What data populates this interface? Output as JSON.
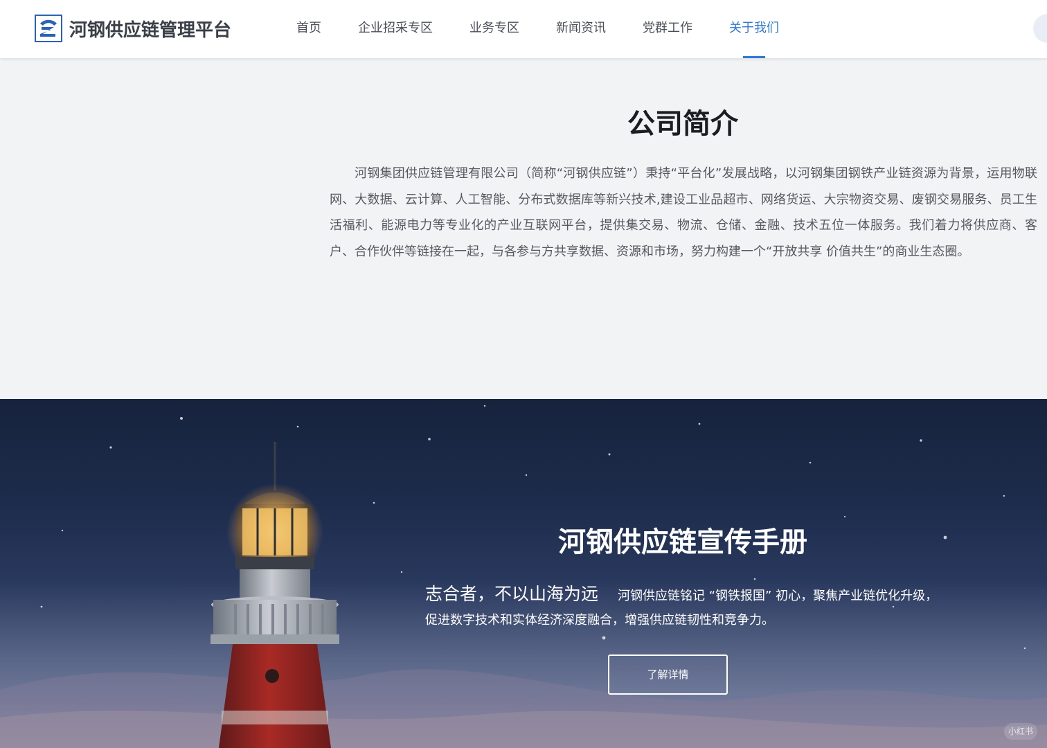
{
  "header": {
    "logo_text": "河钢供应链管理平台",
    "nav": [
      {
        "label": "首页",
        "active": false
      },
      {
        "label": "企业招采专区",
        "active": false
      },
      {
        "label": "业务专区",
        "active": false
      },
      {
        "label": "新闻资讯",
        "active": false
      },
      {
        "label": "党群工作",
        "active": false
      },
      {
        "label": "关于我们",
        "active": true
      }
    ]
  },
  "intro": {
    "title": "公司简介",
    "text": "河钢集团供应链管理有限公司（简称“河钢供应链”）秉持“平台化”发展战略，以河钢集团钢铁产业链资源为背景，运用物联网、大数据、云计算、人工智能、分布式数据库等新兴技术,建设工业品超市、网络货运、大宗物资交易、废钢交易服务、员工生活福利、能源电力等专业化的产业互联网平台，提供集交易、物流、仓储、金融、技术五位一体服务。我们着力将供应商、客户、合作伙伴等链接在一起，与各参与方共享数据、资源和市场，努力构建一个“开放共享 价值共生”的商业生态圈。"
  },
  "banner": {
    "title": "河钢供应链宣传手册",
    "slogan": "志合者，不以山海为远",
    "desc_line1": "河钢供应链铭记 “钢铁报国” 初心，聚焦产业链优化升级，",
    "desc_line2": "促进数字技术和实体经济深度融合，增强供应链韧性和竞争力。",
    "button_label": "了解详情",
    "watermark": "小红书"
  },
  "colors": {
    "accent": "#2f78d8",
    "logo_blue": "#2a63b5",
    "intro_bg": "#f2f3f5",
    "banner_dark": "#17233d"
  }
}
